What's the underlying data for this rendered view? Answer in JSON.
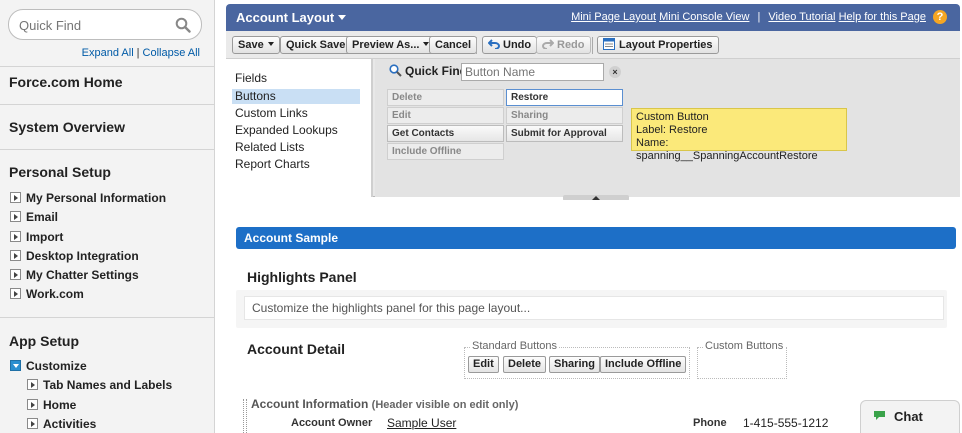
{
  "sidebar": {
    "search_placeholder": "Quick Find",
    "expand_all": "Expand All",
    "separator": "|",
    "collapse_all": "Collapse All",
    "force_home": "Force.com Home",
    "system_overview": "System Overview",
    "personal_setup": {
      "heading": "Personal Setup",
      "items": [
        "My Personal Information",
        "Email",
        "Import",
        "Desktop Integration",
        "My Chatter Settings",
        "Work.com"
      ]
    },
    "app_setup": {
      "heading": "App Setup",
      "customize": "Customize",
      "sub_items": [
        "Tab Names and Labels",
        "Home",
        "Activities"
      ]
    }
  },
  "header": {
    "title": "Account Layout",
    "links": [
      "Mini Page Layout",
      "Mini Console View",
      "|",
      "Video Tutorial",
      "Help for this Page"
    ],
    "help_glyph": "?"
  },
  "toolbar": {
    "save": "Save",
    "quick_save": "Quick Save",
    "preview_as": "Preview As...",
    "cancel": "Cancel",
    "undo": "Undo",
    "redo": "Redo",
    "layout_properties": "Layout Properties"
  },
  "palette": {
    "categories": [
      "Fields",
      "Buttons",
      "Custom Links",
      "Expanded Lookups",
      "Related Lists",
      "Report Charts"
    ],
    "selected_category": "Buttons",
    "quick_find_label": "Quick Find",
    "quick_find_placeholder": "Button Name",
    "clear_glyph": "×",
    "buttons_col1": [
      "Delete",
      "Edit",
      "Get Contacts",
      "Include Offline"
    ],
    "buttons_col2": [
      "Restore",
      "Sharing",
      "Submit for Approval"
    ],
    "tooltip": {
      "line1": "Custom Button",
      "line2": "Label: Restore",
      "line3": "Name: spanning__SpanningAccountRestore"
    }
  },
  "canvas": {
    "section_title": "Account Sample",
    "highlights_title": "Highlights Panel",
    "highlights_placeholder": "Customize the highlights panel for this page layout...",
    "detail_title": "Account Detail",
    "standard_buttons_label": "Standard Buttons",
    "standard_buttons": [
      "Edit",
      "Delete",
      "Sharing",
      "Include Offline"
    ],
    "custom_buttons_label": "Custom Buttons",
    "info_title": "Account Information",
    "info_sub": "(Header visible on edit only)",
    "owner_label": "Account Owner",
    "owner_value": "Sample User",
    "phone_label": "Phone",
    "phone_value": "1-415-555-1212"
  },
  "chat": {
    "label": "Chat"
  },
  "colors": {
    "title_bar": "#4a66a0",
    "section_bar": "#1d6fc7",
    "tooltip_bg": "#fbe97a",
    "selected_category": "#c9dff4",
    "help_icon": "#f5a623"
  }
}
